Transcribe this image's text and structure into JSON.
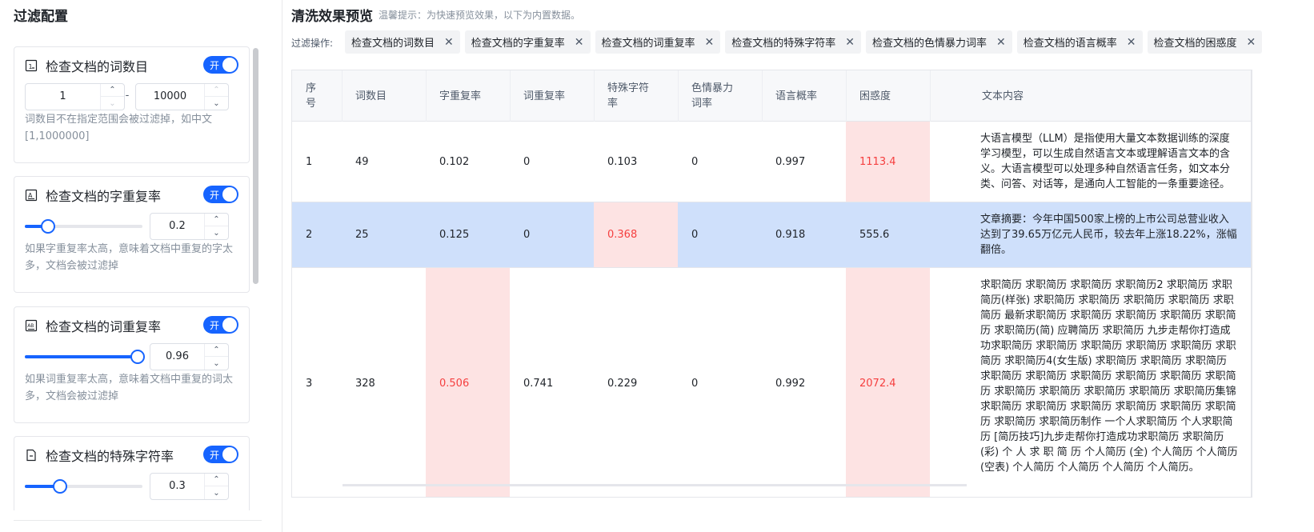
{
  "left": {
    "title": "过滤配置",
    "cards": [
      {
        "title": "检查文档的词数目",
        "switch_label": "开",
        "min_value": "1",
        "separator": "-",
        "max_value": "10000",
        "hint": "词数目不在指定范围会被过滤掉，如中文[1,1000000]"
      },
      {
        "title": "检查文档的字重复率",
        "switch_label": "开",
        "slider_level": 0.2,
        "value": "0.2",
        "hint": "如果字重复率太高，意味着文档中重复的字太多，文档会被过滤掉"
      },
      {
        "title": "检查文档的词重复率",
        "switch_label": "开",
        "slider_level": 0.96,
        "value": "0.96",
        "hint": "如果词重复率太高，意味着文档中重复的词太多，文档会被过滤掉"
      },
      {
        "title": "检查文档的特殊字符率",
        "switch_label": "开",
        "slider_level": 0.3,
        "value": "0.3"
      }
    ]
  },
  "right": {
    "title": "清洗效果预览",
    "tip": "温馨提示：为快速预览效果，以下为内置数据。",
    "filter_label": "过滤操作:",
    "tags": [
      "检查文档的词数目",
      "检查文档的字重复率",
      "检查文档的词重复率",
      "检查文档的特殊字符率",
      "检查文档的色情暴力词率",
      "检查文档的语言概率",
      "检查文档的困惑度"
    ]
  },
  "table": {
    "columns": [
      "序号",
      "词数目",
      "字重复率",
      "词重复率",
      "特殊字符率",
      "色情暴力词率",
      "语言概率",
      "困惑度",
      "文本内容"
    ],
    "rows": [
      {
        "cells": [
          "1",
          "49",
          "0.102",
          "0",
          "0.103",
          "0",
          "0.997",
          "1113.4"
        ],
        "text": "大语言模型（LLM）是指使用大量文本数据训练的深度学习模型，可以生成自然语言文本或理解语言文本的含义。大语言模型可以处理多种自然语言任务，如文本分类、问答、对话等，是通向人工智能的一条重要途径。"
      },
      {
        "cells": [
          "2",
          "25",
          "0.125",
          "0",
          "0.368",
          "0",
          "0.918",
          "555.6"
        ],
        "text": "文章摘要：今年中国500家上榜的上市公司总营业收入达到了39.65万亿元人民币，较去年上涨18.22%，涨幅翻倍。"
      },
      {
        "cells": [
          "3",
          "328",
          "0.506",
          "0.741",
          "0.229",
          "0",
          "0.992",
          "2072.4"
        ],
        "text": "求职简历 求职简历 求职简历 求职简历2 求职简历 求职简历(样张) 求职简历 求职简历 求职简历 求职简历 求职简历 最新求职简历 求职简历 求职简历 求职简历 求职简历 求职简历(简) 应聘简历 求职简历 九步走帮你打造成功求职简历 求职简历 求职简历 求职简历 求职简历 求职简历 求职简历4(女生版) 求职简历 求职简历 求职简历 求职简历 求职简历 求职简历 求职简历 求职简历 求职简历 求职简历 求职简历 求职简历 求职简历 求职简历集锦 求职简历 求职简历 求职简历 求职简历 求职简历 求职简历 求职简历 求职简历制作 一个人求职简历 个人求职简历 [简历技巧]九步走帮你打造成功求职简历 求职简历(彩) 个 人 求 职 简 历 个人简历 (全) 个人简历 个人简历(空表) 个人简历 个人简历 个人简历 个人简历。"
      }
    ]
  }
}
